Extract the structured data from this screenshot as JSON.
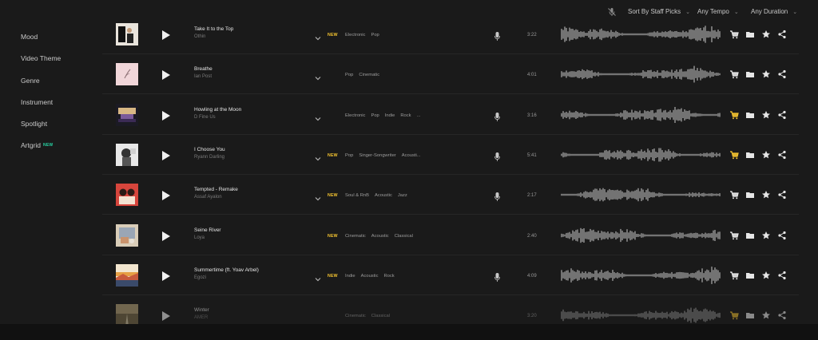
{
  "filters": {
    "sort": "Sort By Staff Picks",
    "tempo": "Any Tempo",
    "duration": "Any Duration"
  },
  "sidebar": {
    "items": [
      {
        "label": "Mood"
      },
      {
        "label": "Video Theme"
      },
      {
        "label": "Genre"
      },
      {
        "label": "Instrument"
      },
      {
        "label": "Spotlight"
      },
      {
        "label": "Artgrid",
        "badge": "NEW"
      }
    ]
  },
  "colors": {
    "accent_new": "#f2c230",
    "accent_badge": "#27d3a3",
    "cart_active": "#f2c230",
    "background": "#1a1a1a"
  },
  "tracks": [
    {
      "title": "Take It to the Top",
      "artist": "Othin",
      "is_new": true,
      "new_label": "NEW",
      "tags": [
        "Electronic",
        "Pop"
      ],
      "vocal": true,
      "duration": "3:22",
      "cart_active": false,
      "expandable": true
    },
    {
      "title": "Breathe",
      "artist": "Ian Post",
      "is_new": false,
      "new_label": "",
      "tags": [
        "Pop",
        "Cinematic"
      ],
      "vocal": false,
      "duration": "4:01",
      "cart_active": false,
      "expandable": true
    },
    {
      "title": "Howling at the Moon",
      "artist": "D Fine Us",
      "is_new": false,
      "new_label": "",
      "tags": [
        "Electronic",
        "Pop",
        "Indie",
        "Rock",
        "..."
      ],
      "vocal": true,
      "duration": "3:16",
      "cart_active": true,
      "expandable": true
    },
    {
      "title": "I Choose You",
      "artist": "Ryann Darling",
      "is_new": true,
      "new_label": "NEW",
      "tags": [
        "Pop",
        "Singer-Songwriter",
        "Acousti..."
      ],
      "vocal": true,
      "duration": "5:41",
      "cart_active": true,
      "expandable": true
    },
    {
      "title": "Tempted - Remake",
      "artist": "Assaf Ayalon",
      "is_new": true,
      "new_label": "NEW",
      "tags": [
        "Soul & RnB",
        "Acoustic",
        "Jazz"
      ],
      "vocal": true,
      "duration": "2:17",
      "cart_active": false,
      "expandable": true
    },
    {
      "title": "Seine River",
      "artist": "Loya",
      "is_new": true,
      "new_label": "NEW",
      "tags": [
        "Cinematic",
        "Acoustic",
        "Classical"
      ],
      "vocal": false,
      "duration": "2:40",
      "cart_active": false,
      "expandable": false
    },
    {
      "title": "Summertime (ft. Yoav Arbel)",
      "artist": "Egozi",
      "is_new": true,
      "new_label": "NEW",
      "tags": [
        "Indie",
        "Acoustic",
        "Rock"
      ],
      "vocal": true,
      "duration": "4:09",
      "cart_active": false,
      "expandable": true
    },
    {
      "title": "Winter",
      "artist": "AMER",
      "is_new": false,
      "new_label": "",
      "tags": [
        "Cinematic",
        "Classical"
      ],
      "vocal": false,
      "duration": "3:20",
      "cart_active": true,
      "expandable": false
    }
  ],
  "icons": {
    "filter_toggle": "mic-off-icon",
    "play": "play-icon",
    "expand": "chevron-down-icon",
    "vocal": "microphone-icon",
    "cart": "cart-icon",
    "folder": "folder-icon",
    "favorite": "star-icon",
    "share": "share-icon"
  }
}
